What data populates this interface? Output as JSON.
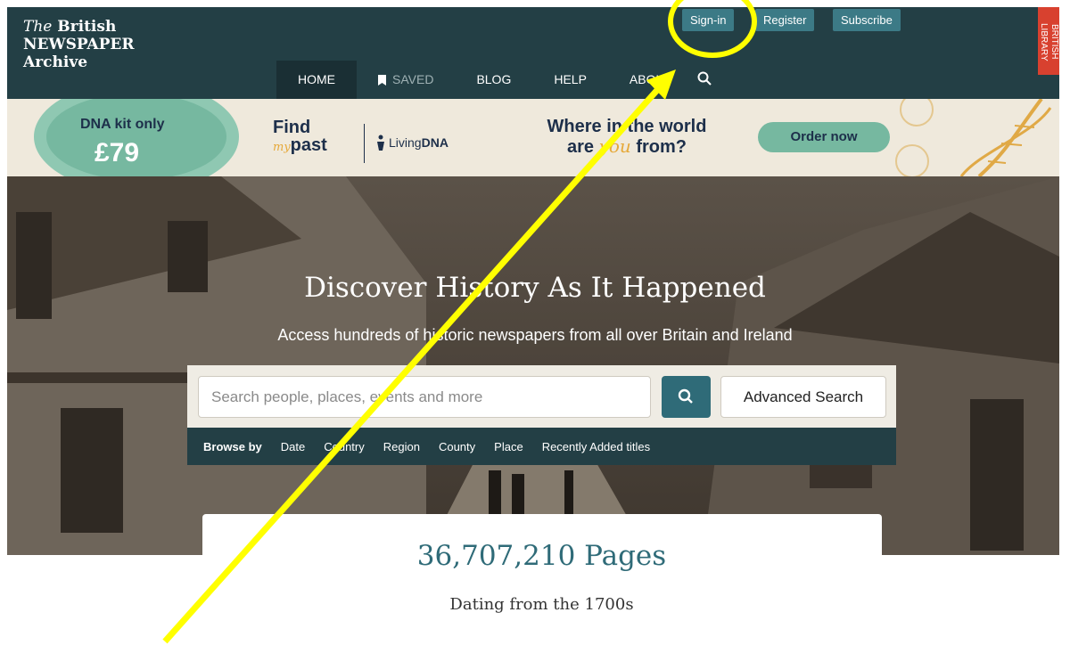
{
  "logo": {
    "line1_italic": "The",
    "line1": "British",
    "line2": "NEWSPAPER",
    "line3": "Archive"
  },
  "top_buttons": {
    "signin": "Sign-in",
    "register": "Register",
    "subscribe": "Subscribe"
  },
  "bl_badge": "BRITISH LIBRARY",
  "nav": {
    "home": "HOME",
    "saved": "SAVED",
    "blog": "BLOG",
    "help": "HELP",
    "about": "ABOUT"
  },
  "banner": {
    "kit": "DNA kit only",
    "price": "£79",
    "find": "Find",
    "my": "my",
    "past": "past",
    "living_a": "Living",
    "living_b": "DNA",
    "where1": "Where in the world",
    "where2_a": "are",
    "where2_you": "you",
    "where2_b": "from?",
    "order": "Order now"
  },
  "hero": {
    "title": "Discover History As It Happened",
    "subtitle": "Access hundreds of historic newspapers from all over Britain and Ireland"
  },
  "search": {
    "placeholder": "Search people, places, events and more",
    "advanced": "Advanced Search"
  },
  "browse": {
    "label": "Browse by",
    "items": [
      "Date",
      "Country",
      "Region",
      "County",
      "Place",
      "Recently Added titles"
    ]
  },
  "stats": {
    "pages": "36,707,210 Pages",
    "dating": "Dating from the 1700s"
  },
  "colors": {
    "header": "#233f45",
    "accent": "#3c7a86",
    "annotation": "#ffff00",
    "bl_red": "#d8412f"
  }
}
